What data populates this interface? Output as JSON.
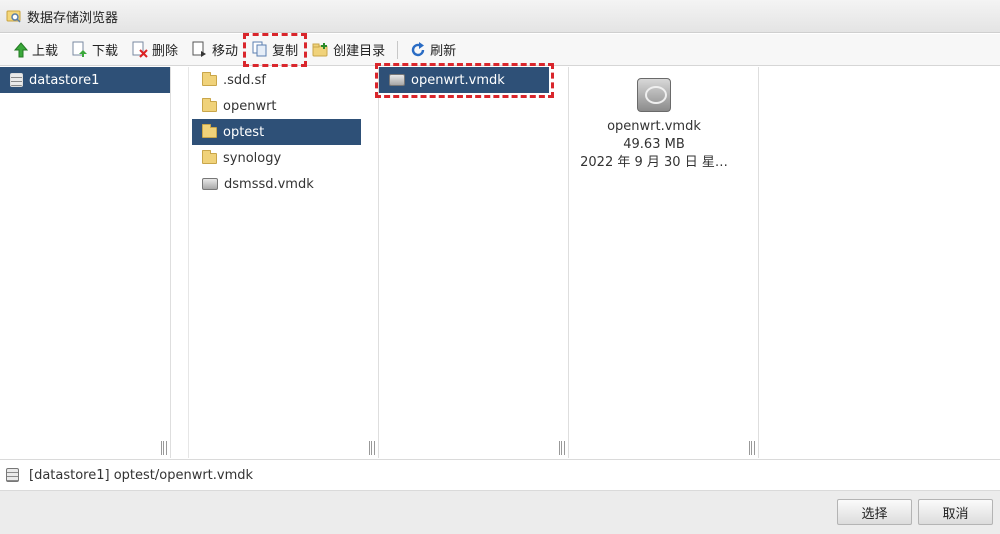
{
  "window": {
    "title": "数据存储浏览器"
  },
  "toolbar": {
    "upload": "上载",
    "download": "下载",
    "delete": "删除",
    "move": "移动",
    "copy": "复制",
    "mkdir": "创建目录",
    "refresh": "刷新"
  },
  "column1": {
    "items": [
      {
        "label": "datastore1",
        "icon": "database-icon",
        "selected": true
      }
    ]
  },
  "column2": {
    "items": [
      {
        "label": ".sdd.sf",
        "icon": "folder-icon"
      },
      {
        "label": "openwrt",
        "icon": "folder-icon"
      },
      {
        "label": "optest",
        "icon": "folder-icon",
        "selected": true
      },
      {
        "label": "synology",
        "icon": "folder-icon"
      },
      {
        "label": "dsmssd.vmdk",
        "icon": "disk-icon"
      }
    ]
  },
  "column3": {
    "items": [
      {
        "label": "openwrt.vmdk",
        "icon": "disk-icon",
        "selected": true
      }
    ]
  },
  "preview": {
    "name": "openwrt.vmdk",
    "size": "49.63 MB",
    "date": "2022 年 9 月 30 日 星…"
  },
  "status": {
    "path": "[datastore1] optest/openwrt.vmdk"
  },
  "footer": {
    "select": "选择",
    "cancel": "取消"
  },
  "colors": {
    "selection": "#2e5077",
    "highlight": "#d9262c"
  }
}
